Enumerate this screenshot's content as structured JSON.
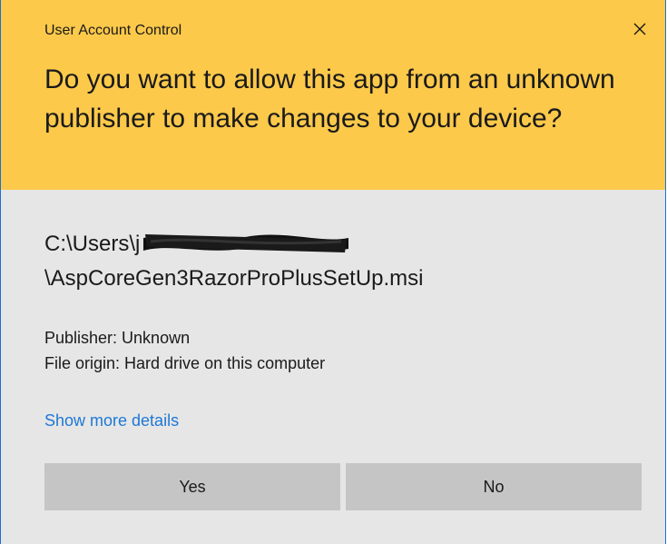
{
  "dialog": {
    "window_title": "User Account Control",
    "question": "Do you want to allow this app from an unknown publisher to make changes to your device?",
    "path_line1_prefix": "C:\\Users\\j",
    "path_line2": "\\AspCoreGen3RazorProPlusSetUp.msi",
    "publisher": "Publisher: Unknown",
    "file_origin": "File origin: Hard drive on this computer",
    "more_details_link": "Show more details",
    "yes_label": "Yes",
    "no_label": "No"
  },
  "icons": {
    "close": "close-icon"
  },
  "colors": {
    "header_bg": "#fcc94a",
    "body_bg": "#e6e6e6",
    "button_bg": "#c5c5c5",
    "link": "#1d78d6",
    "border": "#1f6fd0"
  }
}
